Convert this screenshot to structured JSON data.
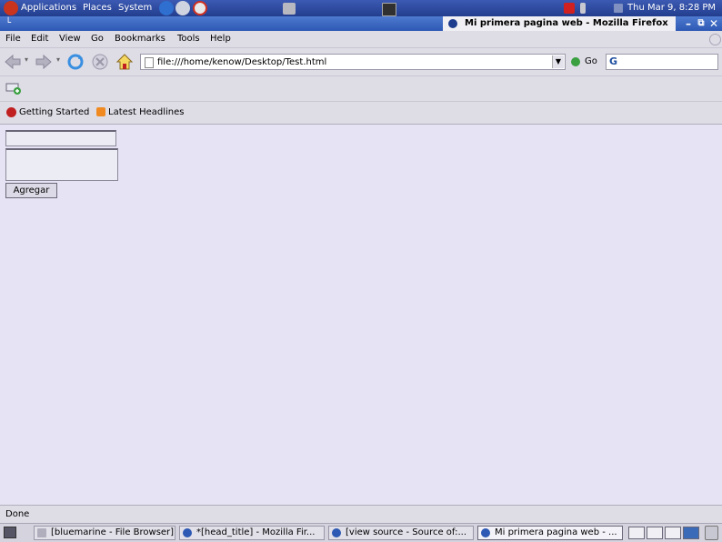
{
  "top_panel": {
    "menus": [
      "Applications",
      "Places",
      "System"
    ],
    "clock": "Thu Mar 9, 8:28 PM"
  },
  "window": {
    "title": "Mi primera pagina web - Mozilla Firefox"
  },
  "menubar": {
    "items": [
      "File",
      "Edit",
      "View",
      "Go",
      "Bookmarks",
      "Tools",
      "Help"
    ]
  },
  "navbar": {
    "url": "file:///home/kenow/Desktop/Test.html",
    "go_label": "Go"
  },
  "bookmarks": {
    "items": [
      "Getting Started",
      "Latest Headlines"
    ]
  },
  "content": {
    "button_label": "Agregar"
  },
  "status": {
    "text": "Done"
  },
  "taskbar": {
    "tasks": [
      "[bluemarine - File Browser]",
      "*[head_title] - Mozilla Fir...",
      "[view source - Source of:...",
      "Mi primera pagina web - ..."
    ]
  }
}
